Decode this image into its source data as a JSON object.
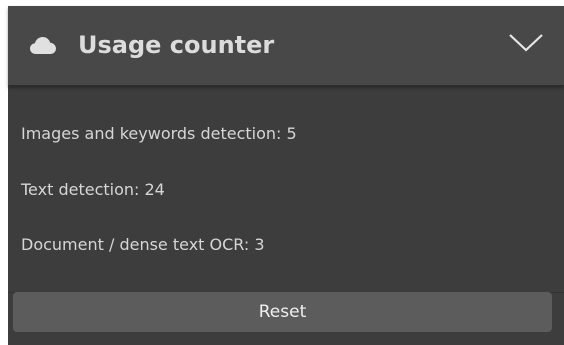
{
  "panel": {
    "title": "Usage counter",
    "icon": "cloud-icon",
    "toggle_icon": "chevron-down-icon"
  },
  "counters": [
    {
      "label": "Images and keywords detection: 5"
    },
    {
      "label": "Text detection: 24"
    },
    {
      "label": "Document / dense text OCR: 3"
    }
  ],
  "actions": {
    "reset_label": "Reset"
  },
  "colors": {
    "panel_background": "#3d3d3d",
    "header_background": "#484848",
    "button_background": "#5c5c5c",
    "text": "#d6d6d6"
  }
}
